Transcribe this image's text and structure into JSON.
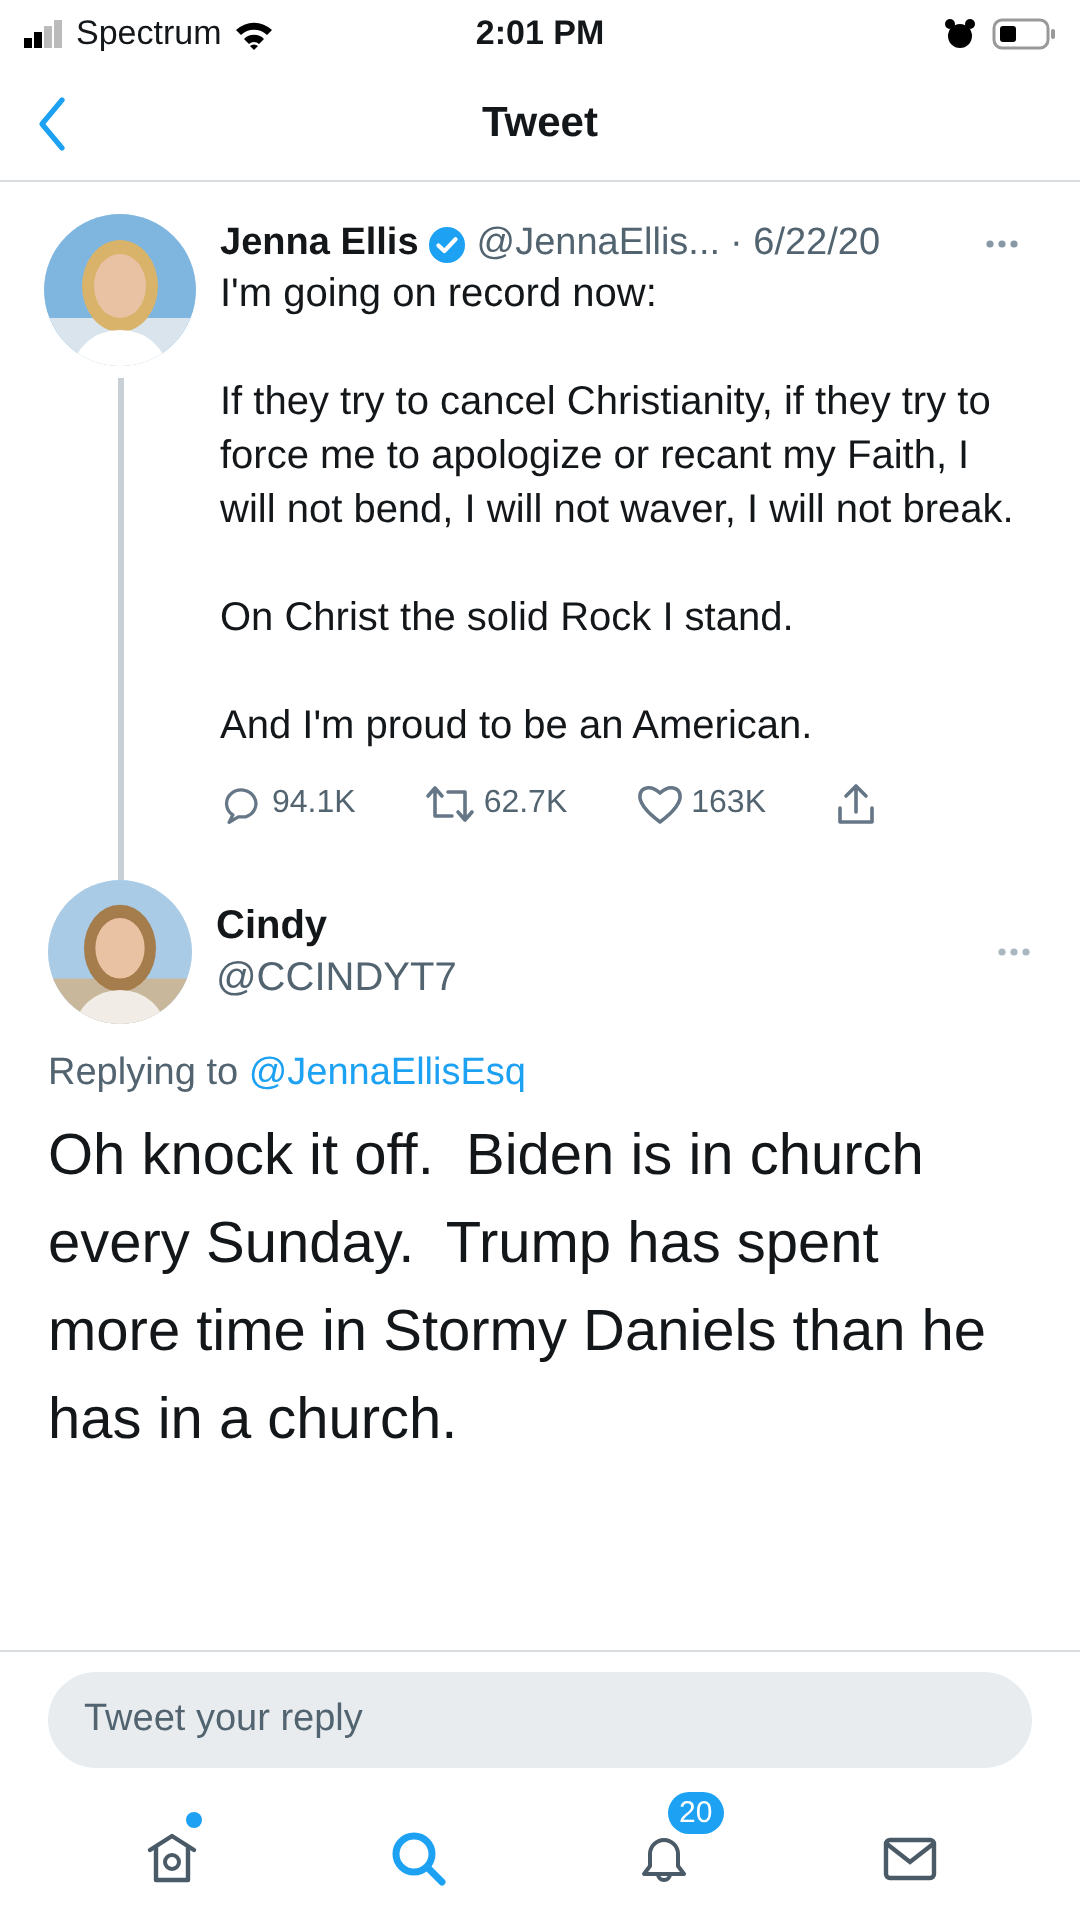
{
  "status_bar": {
    "carrier": "Spectrum",
    "time": "2:01 PM"
  },
  "header": {
    "title": "Tweet"
  },
  "tweet": {
    "author": "Jenna Ellis",
    "verified": true,
    "handle": "@JennaEllis...",
    "date": "· 6/22/20",
    "paragraphs": [
      "I'm going on record now:",
      "If they try to cancel Christianity, if they try to force me to apologize or recant my Faith, I will not bend, I will not waver, I will not break.",
      "On Christ the solid Rock I stand.",
      "And I'm proud to be an American."
    ],
    "actions": [
      {
        "kind": "reply",
        "count": "94.1K"
      },
      {
        "kind": "retweet",
        "count": "62.7K"
      },
      {
        "kind": "like",
        "count": "163K"
      },
      {
        "kind": "share"
      }
    ]
  },
  "reply": {
    "author": "Cindy",
    "handle": "@CCINDYT7",
    "replying_to": "Replying to",
    "replying_to_handle": "@JennaEllisEsq",
    "text": "Oh knock it off.  Biden is in church every Sunday.  Trump has spent more time in Stormy Daniels than he has in a church."
  },
  "composer": {
    "placeholder": "Tweet your reply"
  },
  "tab_bar": [
    {
      "kind": "home",
      "selected": false,
      "unread": true
    },
    {
      "kind": "search",
      "selected": true,
      "unread": false
    },
    {
      "kind": "notifications",
      "selected": false,
      "unread": false,
      "badge": "20"
    },
    {
      "kind": "messages",
      "selected": false,
      "unread": false
    }
  ]
}
